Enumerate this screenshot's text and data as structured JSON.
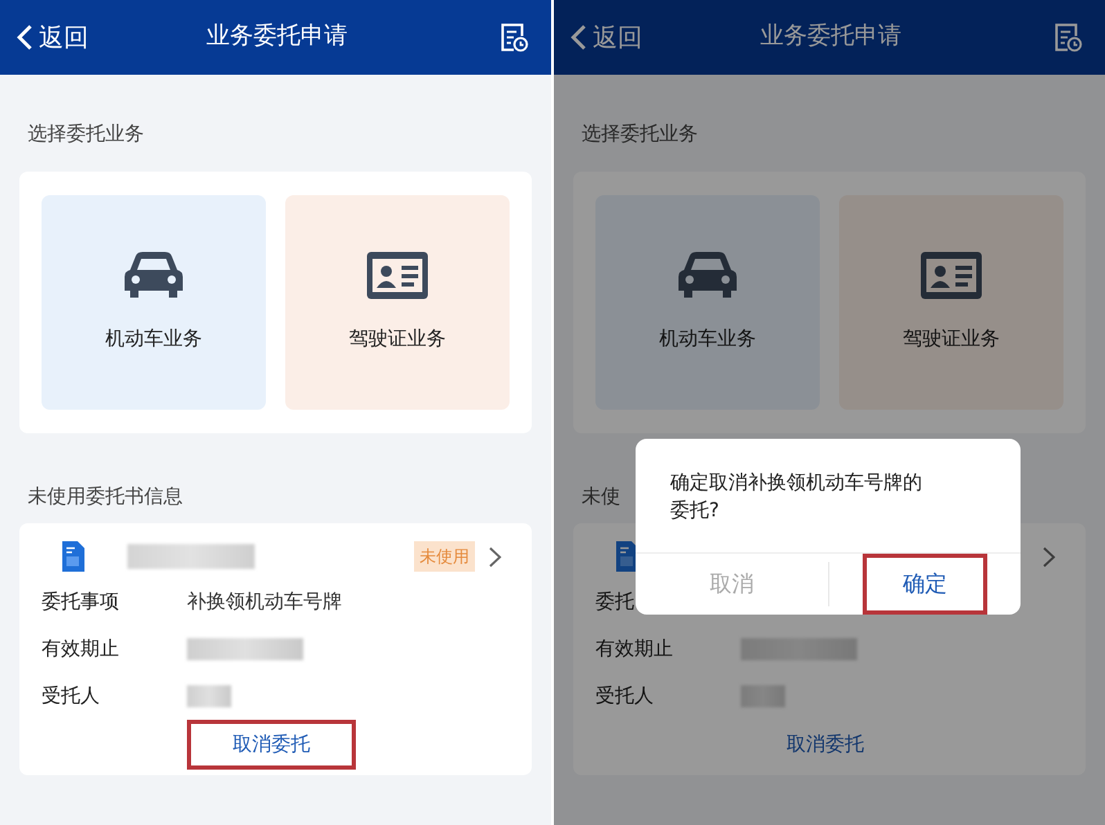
{
  "panels": [
    {
      "header": {
        "back": "返回",
        "title": "业务委托申请"
      },
      "choose_title": "选择委托业务",
      "services": [
        {
          "label": "机动车业务",
          "kind": "car"
        },
        {
          "label": "驾驶证业务",
          "kind": "license"
        }
      ],
      "unused_title": "未使用委托书信息",
      "entrust": {
        "name_redacted": true,
        "badge": "未使用",
        "rows": [
          {
            "label": "委托事项",
            "value": "补换领机动车号牌"
          },
          {
            "label": "有效期止",
            "redacted": true
          },
          {
            "label": "受托人",
            "redacted": true
          }
        ],
        "cancel_button": {
          "label": "取消委托",
          "highlighted": true
        }
      }
    },
    {
      "header": {
        "back": "返回",
        "title": "业务委托申请"
      },
      "choose_title": "选择委托业务",
      "services": [
        {
          "label": "机动车业务",
          "kind": "car"
        },
        {
          "label": "驾驶证业务",
          "kind": "license"
        }
      ],
      "unused_title": "未使",
      "entrust": {
        "rows": [
          {
            "label": "委托"
          },
          {
            "label": "有效期止",
            "redacted": true
          },
          {
            "label": "受托人",
            "redacted": true
          }
        ],
        "cancel_button": {
          "label": "取消委托",
          "highlighted": false
        }
      },
      "dialog": {
        "message": "确定取消补换领机动车号牌的委托?",
        "buttons": [
          {
            "label": "取消",
            "kind": "cancel",
            "highlighted": false
          },
          {
            "label": "确定",
            "kind": "confirm",
            "highlighted": true
          }
        ]
      }
    }
  ]
}
